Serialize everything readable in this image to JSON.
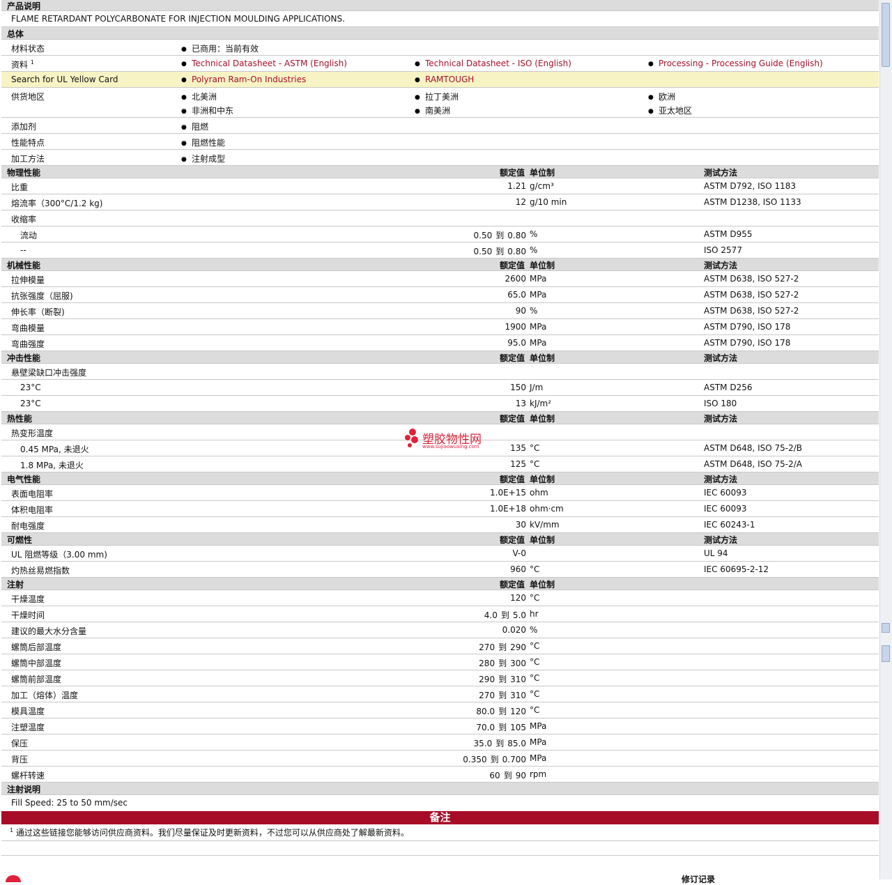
{
  "sections": {
    "desc": "产品说明",
    "general": "总体",
    "physical": "物理性能",
    "mechanical": "机械性能",
    "impact": "冲击性能",
    "thermal": "热性能",
    "electrical": "电气性能",
    "flammability": "可燃性",
    "injection": "注射",
    "injection_notes": "注射说明"
  },
  "headers": {
    "value": "额定值",
    "unit": "单位制",
    "method": "测试方法"
  },
  "description_text": "FLAME RETARDANT POLYCARBONATE FOR INJECTION MOULDING APPLICATIONS.",
  "general": {
    "status_label": "材料状态",
    "status_value": "已商用：当前有效",
    "docs_label": "资料",
    "docs_sup": "1",
    "docs": [
      "Technical Datasheet - ASTM (English)",
      "Technical Datasheet - ISO (English)",
      "Processing - Processing Guide (English)"
    ],
    "ul_label": "Search for UL Yellow Card",
    "ul_links": [
      "Polyram Ram-On Industries",
      "RAMTOUGH"
    ],
    "region_label": "供货地区",
    "regions": [
      "北美洲",
      "拉丁美洲",
      "欧洲",
      "非洲和中东",
      "南美洲",
      "亚太地区"
    ],
    "additive_label": "添加剂",
    "additive_value": "阻燃",
    "feature_label": "性能特点",
    "feature_value": "阻燃性能",
    "process_label": "加工方法",
    "process_value": "注射成型"
  },
  "to_word": "到",
  "physical": [
    {
      "label": "比重",
      "value": "1.21",
      "unit": "g/cm³",
      "method": "ASTM D792, ISO 1183"
    },
    {
      "label": "熔流率（300°C/1.2 kg)",
      "value": "12",
      "unit": "g/10 min",
      "method": "ASTM D1238, ISO 1133"
    },
    {
      "label": "收缩率",
      "value": "",
      "unit": "",
      "method": ""
    },
    {
      "label": "流动",
      "indent": true,
      "lo": "0.50",
      "hi": "0.80",
      "unit": "%",
      "method": "ASTM D955"
    },
    {
      "label": "--",
      "indent": true,
      "lo": "0.50",
      "hi": "0.80",
      "unit": "%",
      "method": "ISO 2577"
    }
  ],
  "mechanical": [
    {
      "label": "拉伸模量",
      "value": "2600",
      "unit": "MPa",
      "method": "ASTM D638, ISO 527-2"
    },
    {
      "label": "抗张强度（屈服)",
      "value": "65.0",
      "unit": "MPa",
      "method": "ASTM D638, ISO 527-2"
    },
    {
      "label": "伸长率（断裂)",
      "value": "90",
      "unit": "%",
      "method": "ASTM D638, ISO 527-2"
    },
    {
      "label": "弯曲模量",
      "value": "1900",
      "unit": "MPa",
      "method": "ASTM D790, ISO 178"
    },
    {
      "label": "弯曲强度",
      "value": "95.0",
      "unit": "MPa",
      "method": "ASTM D790, ISO 178"
    }
  ],
  "impact": [
    {
      "label": "悬壁梁缺口冲击强度",
      "value": "",
      "unit": "",
      "method": ""
    },
    {
      "label": "23°C",
      "indent": true,
      "value": "150",
      "unit": "J/m",
      "method": "ASTM D256"
    },
    {
      "label": "23°C",
      "indent": true,
      "value": "13",
      "unit": "kJ/m²",
      "method": "ISO 180"
    }
  ],
  "thermal": [
    {
      "label": "热变形温度",
      "value": "",
      "unit": "",
      "method": ""
    },
    {
      "label": "0.45 MPa, 未退火",
      "indent": true,
      "value": "135",
      "unit": "°C",
      "method": "ASTM D648, ISO 75-2/B"
    },
    {
      "label": "1.8 MPa, 未退火",
      "indent": true,
      "value": "125",
      "unit": "°C",
      "method": "ASTM D648, ISO 75-2/A"
    }
  ],
  "electrical": [
    {
      "label": "表面电阻率",
      "value": "1.0E+15",
      "unit": "ohm",
      "method": "IEC 60093"
    },
    {
      "label": "体积电阻率",
      "value": "1.0E+18",
      "unit": "ohm·cm",
      "method": "IEC 60093"
    },
    {
      "label": "耐电强度",
      "value": "30",
      "unit": "kV/mm",
      "method": "IEC 60243-1"
    }
  ],
  "flammability": [
    {
      "label": "UL 阻燃等级（3.00 mm)",
      "value": "V-0",
      "unit": "",
      "method": "UL 94"
    },
    {
      "label": "灼热丝易燃指数",
      "value": "960",
      "unit": "°C",
      "method": "IEC 60695-2-12"
    }
  ],
  "injection": [
    {
      "label": "干燥温度",
      "value": "120",
      "unit": "°C"
    },
    {
      "label": "干燥时间",
      "lo": "4.0",
      "hi": "5.0",
      "unit": "hr"
    },
    {
      "label": "建议的最大水分含量",
      "value": "0.020",
      "unit": "%"
    },
    {
      "label": "螺筒后部温度",
      "lo": "270",
      "hi": "290",
      "unit": "°C"
    },
    {
      "label": "螺筒中部温度",
      "lo": "280",
      "hi": "300",
      "unit": "°C"
    },
    {
      "label": "螺筒前部温度",
      "lo": "290",
      "hi": "310",
      "unit": "°C"
    },
    {
      "label": "加工（熔体）温度",
      "lo": "270",
      "hi": "310",
      "unit": "°C"
    },
    {
      "label": "模具温度",
      "lo": "80.0",
      "hi": "120",
      "unit": "°C"
    },
    {
      "label": "注塑温度",
      "lo": "70.0",
      "hi": "105",
      "unit": "MPa"
    },
    {
      "label": "保压",
      "lo": "35.0",
      "hi": "85.0",
      "unit": "MPa"
    },
    {
      "label": "背压",
      "lo": "0.350",
      "hi": "0.700",
      "unit": "MPa"
    },
    {
      "label": "螺杆转速",
      "lo": "60",
      "hi": "90",
      "unit": "rpm"
    }
  ],
  "injection_note": "Fill Speed: 25 to 50 mm/sec",
  "notes": {
    "title": "备注",
    "sup": "1",
    "text": "通过这些链接您能够访问供应商资料。我们尽量保证及时更新资料，不过您可以从供应商处了解最新资料。"
  },
  "watermark": {
    "text": "塑胶物性网",
    "url": "www.sujiaowuxing.com"
  },
  "bottom_partial": "修订记录"
}
